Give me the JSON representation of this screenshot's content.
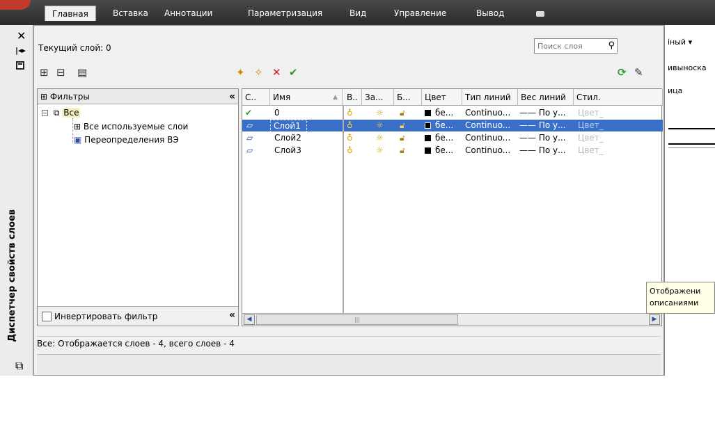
{
  "ribbon": {
    "tabs": [
      "Главная",
      "Вставка",
      "Аннотации",
      "Параметризация",
      "Вид",
      "Управление",
      "Вывод"
    ]
  },
  "background": {
    "text1": "іный ▾",
    "text2": "ивыноска",
    "text3": "ица"
  },
  "palette": {
    "vertical_title": "Диспетчер свойств слоев",
    "current_layer": "Текущий слой: 0",
    "search_placeholder": "Поиск слоя",
    "filters_header": "Фильтры",
    "tree": {
      "root": "Все",
      "child1": "Все используемые слои",
      "child2": "Переопределения ВЭ"
    },
    "invert_filter": "Инвертировать фильтр",
    "columns": [
      "С..",
      "Имя",
      "В..",
      "За...",
      "Б...",
      "Цвет",
      "Тип линий",
      "Вес линий",
      "Стил."
    ],
    "rows": [
      {
        "name": "0",
        "color": "бе...",
        "linetype": "Continuo...",
        "lineweight": "По у...",
        "style": "Цвет_"
      },
      {
        "name": "Слой1",
        "color": "бе...",
        "linetype": "Continuo...",
        "lineweight": "По у...",
        "style": "Цвет_"
      },
      {
        "name": "Слой2",
        "color": "бе...",
        "linetype": "Continuo...",
        "lineweight": "По у...",
        "style": "Цвет_"
      },
      {
        "name": "Слой3",
        "color": "бе...",
        "linetype": "Continuo...",
        "lineweight": "По у...",
        "style": "Цвет_"
      }
    ],
    "selected_row": "Слой1",
    "status": "Все: Отображается слоев - 4, всего слоев - 4"
  },
  "tooltip": {
    "line1": "Отображени",
    "line2": "описаниями"
  },
  "colors": {
    "selection": "#3a6fc7",
    "ribbon_bg": "#333333",
    "current_check": "#2e9a2e",
    "delete_x": "#d02020"
  }
}
